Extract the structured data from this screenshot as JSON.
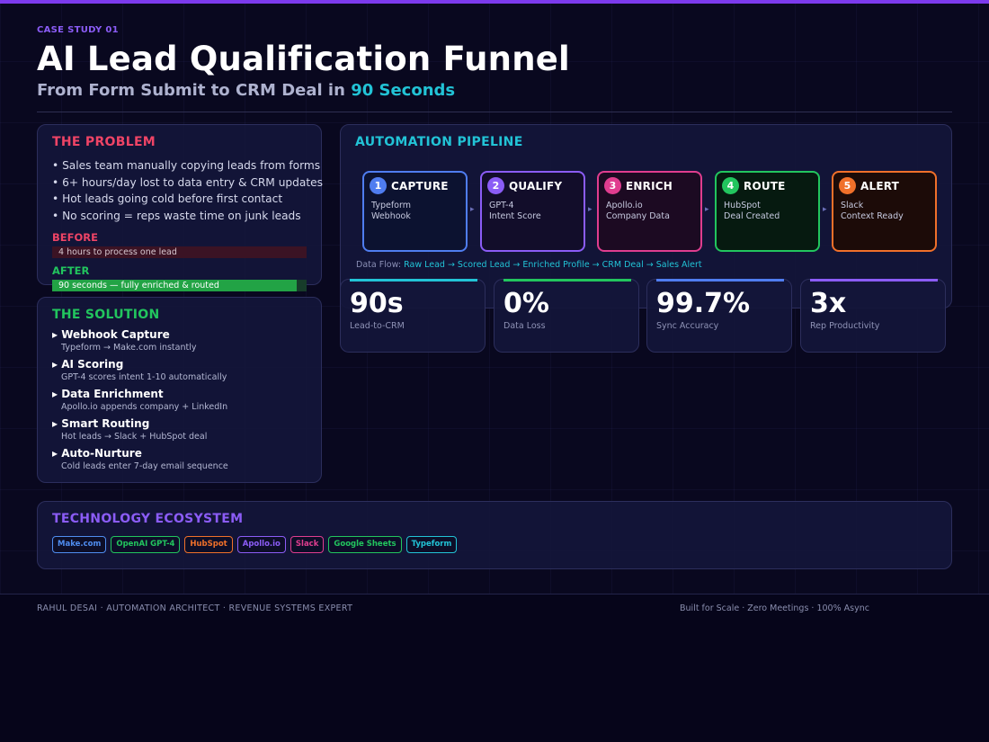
{
  "header": {
    "eyebrow": "CASE STUDY 01",
    "title": "AI Lead Qualification Funnel",
    "subtitle_prefix": "From Form Submit to CRM Deal in",
    "subtitle_accent": "90 Seconds"
  },
  "problem": {
    "heading": "THE PROBLEM",
    "bullets": [
      "• Sales team manually copying leads from forms",
      "• 6+ hours/day lost to data entry & CRM updates",
      "• Hot leads going cold before first contact",
      "• No scoring = reps waste time on junk leads"
    ],
    "before_label": "BEFORE",
    "before_text": "4 hours to process one lead",
    "after_label": "AFTER",
    "after_text": "90 seconds — fully enriched & routed"
  },
  "solution": {
    "heading": "THE SOLUTION",
    "items": [
      {
        "title": "▸ Webhook Capture",
        "desc": "Typeform → Make.com instantly"
      },
      {
        "title": "▸ AI Scoring",
        "desc": "GPT-4 scores intent 1-10 automatically"
      },
      {
        "title": "▸ Data Enrichment",
        "desc": "Apollo.io appends company + LinkedIn"
      },
      {
        "title": "▸ Smart Routing",
        "desc": "Hot leads → Slack + HubSpot deal"
      },
      {
        "title": "▸ Auto-Nurture",
        "desc": "Cold leads enter 7-day email sequence"
      }
    ]
  },
  "pipeline": {
    "heading": "AUTOMATION PIPELINE",
    "stages": [
      {
        "num": "1",
        "name": "CAPTURE",
        "line1": "Typeform",
        "line2": "Webhook",
        "color": "#4f7df0",
        "bg": "#0c1230"
      },
      {
        "num": "2",
        "name": "QUALIFY",
        "line1": "GPT-4",
        "line2": "Intent Score",
        "color": "#8b5cf6",
        "bg": "#120d2a"
      },
      {
        "num": "3",
        "name": "ENRICH",
        "line1": "Apollo.io",
        "line2": "Company Data",
        "color": "#e03d8f",
        "bg": "#1c0a22"
      },
      {
        "num": "4",
        "name": "ROUTE",
        "line1": "HubSpot",
        "line2": "Deal Created",
        "color": "#22c55e",
        "bg": "#061a10"
      },
      {
        "num": "5",
        "name": "ALERT",
        "line1": "Slack",
        "line2": "Context Ready",
        "color": "#f0702a",
        "bg": "#1c0b08"
      }
    ],
    "arrow": "▸",
    "dataflow_label": "Data Flow:",
    "dataflow_text": "Raw Lead → Scored Lead → Enriched Profile → CRM Deal → Sales Alert"
  },
  "stats": [
    {
      "value": "90s",
      "label": "Lead-to-CRM",
      "color": "#22c3d6"
    },
    {
      "value": "0%",
      "label": "Data Loss",
      "color": "#22c55e"
    },
    {
      "value": "99.7%",
      "label": "Sync Accuracy",
      "color": "#4f7df0"
    },
    {
      "value": "3x",
      "label": "Rep Productivity",
      "color": "#8b5cf6"
    }
  ],
  "tech": {
    "heading": "TECHNOLOGY ECOSYSTEM",
    "chips": [
      {
        "label": "Make.com",
        "color": "#4f8df0"
      },
      {
        "label": "OpenAI GPT-4",
        "color": "#22c55e"
      },
      {
        "label": "HubSpot",
        "color": "#f0702a"
      },
      {
        "label": "Apollo.io",
        "color": "#8b5cf6"
      },
      {
        "label": "Slack",
        "color": "#e03d8f"
      },
      {
        "label": "Google Sheets",
        "color": "#22c55e"
      },
      {
        "label": "Typeform",
        "color": "#22c3d6"
      }
    ]
  },
  "footer": {
    "left": "RAHUL DESAI  ·  AUTOMATION ARCHITECT  ·  REVENUE SYSTEMS EXPERT",
    "right": "Built for Scale · Zero Meetings · 100% Async"
  }
}
